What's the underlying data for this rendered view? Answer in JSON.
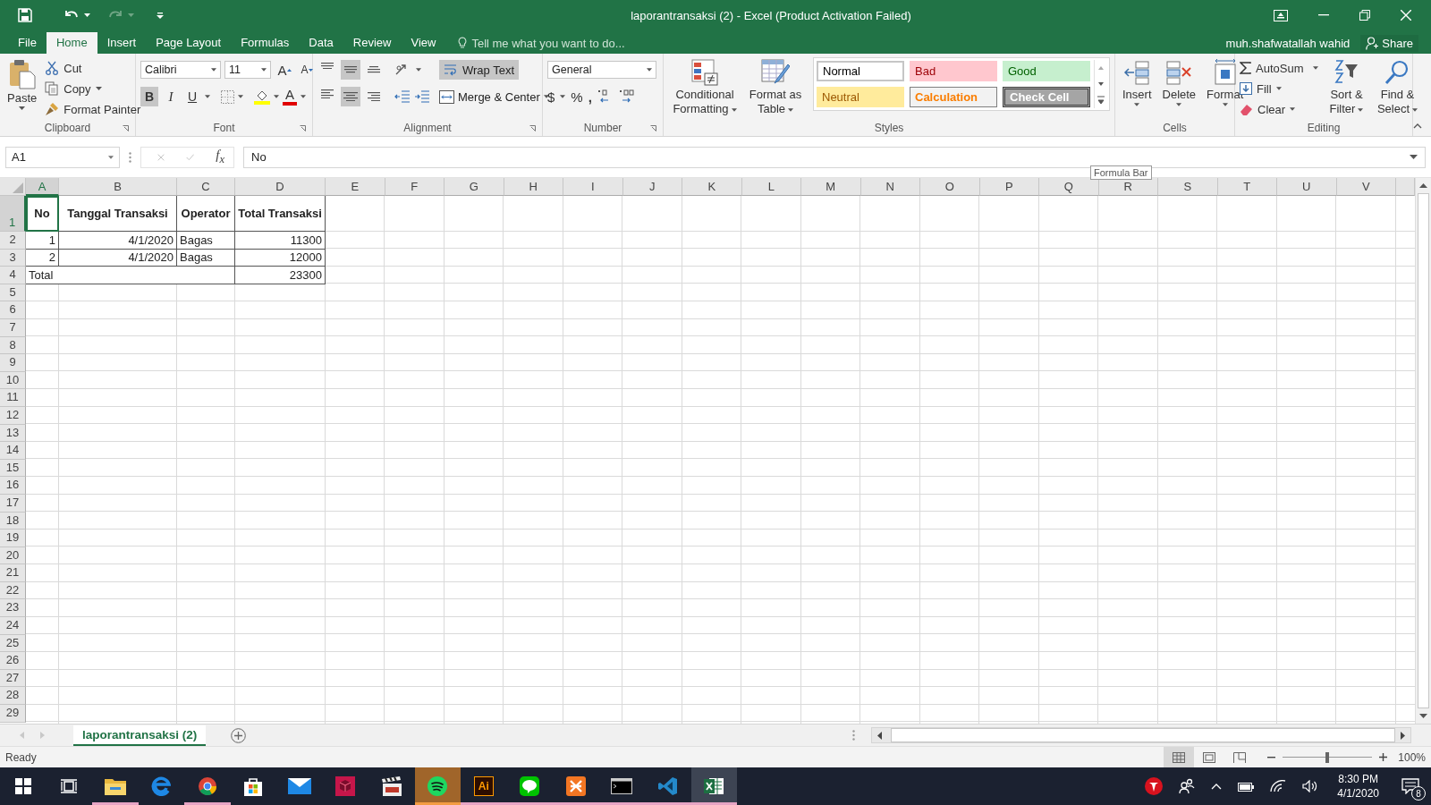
{
  "window": {
    "title": "laporantransaksi (2) - Excel (Product Activation Failed)"
  },
  "account": {
    "user": "muh.shafwatallah wahid",
    "share": "Share"
  },
  "tabs": [
    {
      "label": "File",
      "selected": false
    },
    {
      "label": "Home",
      "selected": true
    },
    {
      "label": "Insert",
      "selected": false
    },
    {
      "label": "Page Layout",
      "selected": false
    },
    {
      "label": "Formulas",
      "selected": false
    },
    {
      "label": "Data",
      "selected": false
    },
    {
      "label": "Review",
      "selected": false
    },
    {
      "label": "View",
      "selected": false
    }
  ],
  "tell_me": {
    "placeholder": "Tell me what you want to do..."
  },
  "ribbon": {
    "clipboard": {
      "label": "Clipboard",
      "paste": "Paste",
      "cut": "Cut",
      "copy": "Copy",
      "format_painter": "Format Painter"
    },
    "font": {
      "label": "Font",
      "font_name": "Calibri",
      "font_size": "11",
      "grow": "A",
      "shrink": "A",
      "bold": {
        "label": "B",
        "on": true
      },
      "italic": {
        "label": "I",
        "on": false
      },
      "underline": {
        "label": "U",
        "on": false
      },
      "font_color": "A"
    },
    "alignment": {
      "label": "Alignment",
      "vertical": [
        {
          "kind": "top",
          "selected": false
        },
        {
          "kind": "middle",
          "selected": true
        },
        {
          "kind": "bottom",
          "selected": false
        }
      ],
      "horizontal": [
        {
          "kind": "left",
          "selected": false
        },
        {
          "kind": "center",
          "selected": true
        },
        {
          "kind": "right",
          "selected": false
        }
      ],
      "wrap_text": {
        "label": "Wrap Text",
        "on": true
      },
      "merge": "Merge & Center"
    },
    "number": {
      "label": "Number",
      "format": "General",
      "currency": "$",
      "percent": "%",
      "comma": ","
    },
    "styles": {
      "label": "Styles",
      "conditional": "Conditional Formatting",
      "format_table": "Format as Table",
      "gallery": [
        {
          "label": "Normal",
          "kind": "normal"
        },
        {
          "label": "Bad",
          "kind": "bad"
        },
        {
          "label": "Good",
          "kind": "good"
        },
        {
          "label": "Neutral",
          "kind": "neutral"
        },
        {
          "label": "Calculation",
          "kind": "calculation"
        },
        {
          "label": "Check Cell",
          "kind": "check"
        }
      ]
    },
    "cells": {
      "label": "Cells",
      "insert": "Insert",
      "delete": "Delete",
      "format": "Format"
    },
    "editing": {
      "label": "Editing",
      "autosum": "AutoSum",
      "fill": "Fill",
      "clear": "Clear",
      "sort": "Sort & Filter",
      "find": "Find & Select"
    }
  },
  "formula_bar": {
    "name_box": "A1",
    "fx": "f$_{x}$",
    "value": "No"
  },
  "tooltip": "Formula Bar",
  "sheet": {
    "columns": [
      {
        "label": "A",
        "selected": true
      },
      {
        "label": "B",
        "selected": false
      },
      {
        "label": "C",
        "selected": false
      },
      {
        "label": "D",
        "selected": false
      },
      {
        "label": "E",
        "selected": false
      },
      {
        "label": "F",
        "selected": false
      },
      {
        "label": "G",
        "selected": false
      },
      {
        "label": "H",
        "selected": false
      },
      {
        "label": "I",
        "selected": false
      },
      {
        "label": "J",
        "selected": false
      },
      {
        "label": "K",
        "selected": false
      },
      {
        "label": "L",
        "selected": false
      },
      {
        "label": "M",
        "selected": false
      },
      {
        "label": "N",
        "selected": false
      },
      {
        "label": "O",
        "selected": false
      },
      {
        "label": "P",
        "selected": false
      },
      {
        "label": "Q",
        "selected": false
      },
      {
        "label": "R",
        "selected": false
      },
      {
        "label": "S",
        "selected": false
      },
      {
        "label": "T",
        "selected": false
      },
      {
        "label": "U",
        "selected": false
      },
      {
        "label": "V",
        "selected": false
      }
    ],
    "rows": [
      {
        "label": "1",
        "selected": true,
        "cells": [
          {
            "text": "No",
            "kind": "heading",
            "selected": true
          },
          {
            "text": "Tanggal Transaksi",
            "kind": "heading",
            "selected": false
          },
          {
            "text": "Operator",
            "kind": "heading",
            "selected": false
          },
          {
            "text": "Total Transaksi",
            "kind": "heading",
            "selected": false
          }
        ]
      },
      {
        "label": "2",
        "selected": false,
        "cells": [
          {
            "text": "1",
            "kind": "number",
            "selected": false
          },
          {
            "text": "4/1/2020",
            "kind": "number",
            "selected": false
          },
          {
            "text": "Bagas",
            "kind": "text",
            "selected": false
          },
          {
            "text": "11300",
            "kind": "number",
            "selected": false
          }
        ]
      },
      {
        "label": "3",
        "selected": false,
        "cells": [
          {
            "text": "2",
            "kind": "number",
            "selected": false
          },
          {
            "text": "4/1/2020",
            "kind": "number",
            "selected": false
          },
          {
            "text": "Bagas",
            "kind": "text",
            "selected": false
          },
          {
            "text": "12000",
            "kind": "number",
            "selected": false
          }
        ]
      },
      {
        "label": "4",
        "selected": false,
        "cells": [
          {
            "text": "Total",
            "kind": "text",
            "selected": false
          },
          {
            "text": "23300",
            "kind": "number",
            "selected": false
          }
        ]
      },
      {
        "label": "5",
        "selected": false
      },
      {
        "label": "6",
        "selected": false
      },
      {
        "label": "7",
        "selected": false
      },
      {
        "label": "8",
        "selected": false
      },
      {
        "label": "9",
        "selected": false
      },
      {
        "label": "10",
        "selected": false
      },
      {
        "label": "11",
        "selected": false
      },
      {
        "label": "12",
        "selected": false
      },
      {
        "label": "13",
        "selected": false
      },
      {
        "label": "14",
        "selected": false
      },
      {
        "label": "15",
        "selected": false
      },
      {
        "label": "16",
        "selected": false
      },
      {
        "label": "17",
        "selected": false
      },
      {
        "label": "18",
        "selected": false
      },
      {
        "label": "19",
        "selected": false
      },
      {
        "label": "20",
        "selected": false
      },
      {
        "label": "21",
        "selected": false
      },
      {
        "label": "22",
        "selected": false
      },
      {
        "label": "23",
        "selected": false
      },
      {
        "label": "24",
        "selected": false
      },
      {
        "label": "25",
        "selected": false
      },
      {
        "label": "26",
        "selected": false
      },
      {
        "label": "27",
        "selected": false
      },
      {
        "label": "28",
        "selected": false
      },
      {
        "label": "29",
        "selected": false
      }
    ]
  },
  "sheet_tabs": [
    {
      "label": "laporantransaksi (2)",
      "selected": true
    }
  ],
  "status": {
    "text": "Ready",
    "views": [
      {
        "kind": "normal",
        "selected": true
      },
      {
        "kind": "layout",
        "selected": false
      },
      {
        "kind": "break",
        "selected": false
      }
    ],
    "zoom_slider": {
      "level": 0.5
    },
    "zoom": "100%"
  },
  "taskbar": {
    "apps": [
      {
        "kind": "start",
        "running": false,
        "selected": false,
        "highlighted": false
      },
      {
        "kind": "taskview",
        "running": false,
        "selected": false,
        "highlighted": false
      },
      {
        "kind": "explorer",
        "running": true,
        "selected": false,
        "highlighted": false
      },
      {
        "kind": "edge",
        "running": false,
        "selected": false,
        "highlighted": false
      },
      {
        "kind": "chrome",
        "running": true,
        "selected": false,
        "highlighted": false
      },
      {
        "kind": "store",
        "running": false,
        "selected": false,
        "highlighted": false
      },
      {
        "kind": "mail",
        "running": false,
        "selected": false,
        "highlighted": false
      },
      {
        "kind": "cube",
        "running": false,
        "selected": false,
        "highlighted": false
      },
      {
        "kind": "clapper",
        "running": false,
        "selected": false,
        "highlighted": false
      },
      {
        "kind": "spotify",
        "running": true,
        "selected": false,
        "highlighted": true
      },
      {
        "kind": "illustrator",
        "label": "Ai",
        "running": true,
        "selected": false,
        "highlighted": false
      },
      {
        "kind": "line",
        "running": true,
        "selected": false,
        "highlighted": false
      },
      {
        "kind": "xampp",
        "running": true,
        "selected": false,
        "highlighted": false
      },
      {
        "kind": "terminal",
        "running": true,
        "selected": false,
        "highlighted": false
      },
      {
        "kind": "vscode",
        "running": true,
        "selected": false,
        "highlighted": false
      },
      {
        "kind": "excel",
        "running": true,
        "selected": true,
        "highlighted": false
      }
    ],
    "time": "8:30 PM",
    "date": "4/1/2020",
    "notifications": "8"
  }
}
